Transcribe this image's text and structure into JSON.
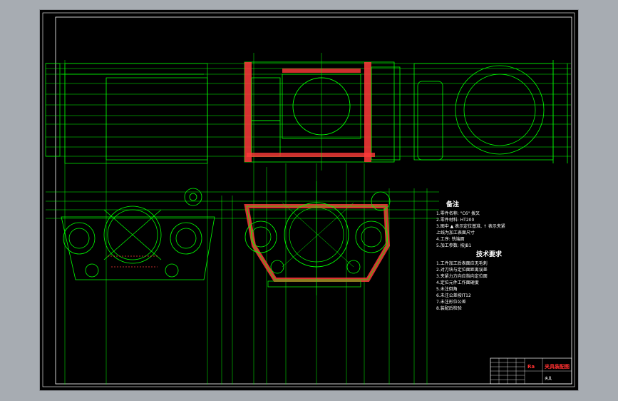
{
  "colors": {
    "background": "#000000",
    "frame": "#ffffff",
    "geometry": "#00ff00",
    "hatch": "#ff3a3a",
    "dims": "#00ff00",
    "chrome": "#a7acb2",
    "accent_blue": "#3da0ff"
  },
  "notes": {
    "title": "备注",
    "lines": [
      "1.零件名称: \"C6\" 拨叉",
      "2.零件材料: HT200",
      "3.图中 ▲ 表示定位基准, ↑ 表示夹紧",
      "   上线为加工表面尺寸",
      "4.工序: 铣端面",
      "5.加工参数: 按JB1"
    ]
  },
  "tech": {
    "title": "技术要求",
    "lines": [
      "1.工件加工后表面应无毛刺",
      "2.对刀块与定位面距离误差",
      "3.夹紧力方向应指向定位面",
      "4.定位元件工作面硬度",
      "5.未注倒角",
      "6.未注公差按IT12",
      "7.未注形位公差",
      "8.装配后检验"
    ]
  },
  "title_block": {
    "red_label_1": "Ra",
    "red_label_2": "夹具装配图",
    "small": "夹具"
  },
  "icons": {
    "view": "cad-drawing-sheet"
  }
}
